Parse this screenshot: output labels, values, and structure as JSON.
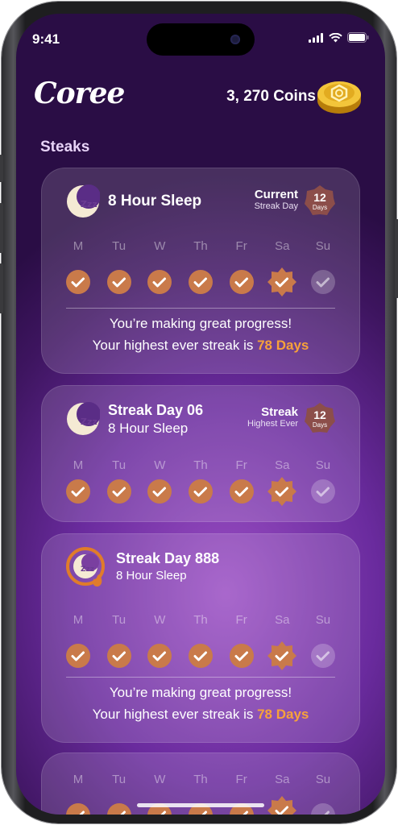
{
  "status": {
    "time": "9:41"
  },
  "header": {
    "logo": "Coree",
    "coins": "3, 270 Coins",
    "coin_icon": "coin-icon"
  },
  "section": {
    "title": "Steaks"
  },
  "days": [
    "M",
    "Tu",
    "W",
    "Th",
    "Fr",
    "Sa",
    "Su"
  ],
  "colors": {
    "accent": "#f7a23a",
    "check": "#c97a4a",
    "badge": "#8c4e4a"
  },
  "cards": [
    {
      "title": "8 Hour Sleep",
      "meta_title": "Current",
      "meta_sub": "Streak Day",
      "badge_num": "12",
      "badge_label": "Days",
      "msg_line1": "You’re making great progress!",
      "msg_line2_prefix": "Your highest ever streak is",
      "msg_highlight": "78 Days"
    },
    {
      "title": "Streak Day 06",
      "subtitle": "8 Hour Sleep",
      "meta_title": "Streak",
      "meta_sub": "Highest Ever",
      "badge_num": "12",
      "badge_label": "Days"
    },
    {
      "title": "Streak Day 888",
      "subtitle": "8 Hour Sleep",
      "msg_line1": "You’re making great progress!",
      "msg_line2_prefix": "Your highest ever streak is",
      "msg_highlight": "78 Days"
    }
  ]
}
